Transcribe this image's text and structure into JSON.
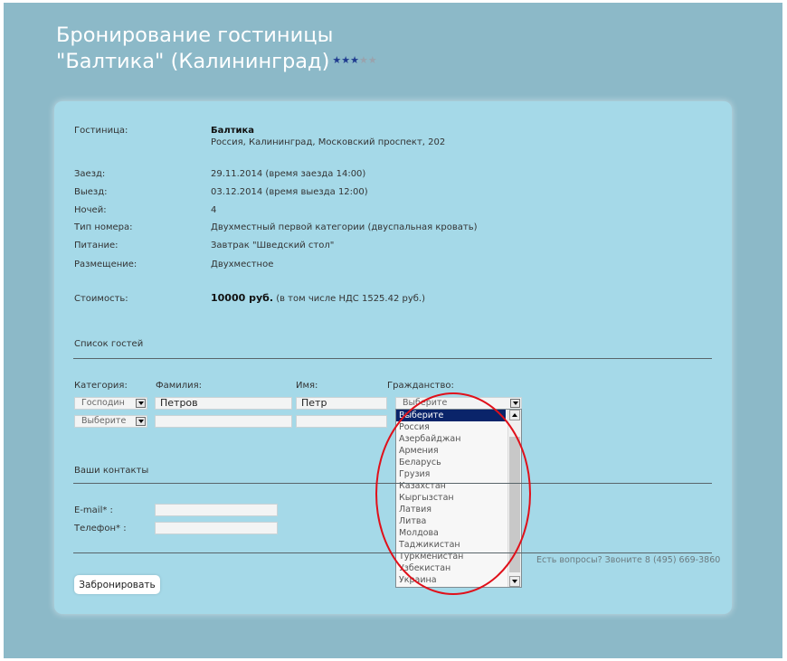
{
  "page": {
    "title_line1": "Бронирование гостиницы",
    "title_line2": "\"Балтика\" (Калининград)",
    "stars_filled": 3,
    "stars_total": 5,
    "colors": {
      "background": "#8cb9c8",
      "card": "#a5d9e8",
      "star_on": "#1f3b8f",
      "star_off": "#9aa3ad",
      "annotation": "#e0101a"
    }
  },
  "booking": {
    "hotel_label": "Гостиница:",
    "hotel_name": "Балтика",
    "hotel_address": "Россия, Калининград, Московский проспект, 202",
    "checkin_label": "Заезд:",
    "checkin_value": "29.11.2014 (время заезда 14:00)",
    "checkout_label": "Выезд:",
    "checkout_value": "03.12.2014 (время выезда 12:00)",
    "nights_label": "Ночей:",
    "nights_value": "4",
    "room_label": "Тип номера:",
    "room_value": "Двухместный первой категории (двуспальная кровать)",
    "meals_label": "Питание:",
    "meals_value": "Завтрак \"Шведский стол\"",
    "placement_label": "Размещение:",
    "placement_value": "Двухместное",
    "cost_label": "Стоимость:",
    "cost_amount": "10000 руб.",
    "cost_note": "(в том числе НДС 1525.42 руб.)"
  },
  "guests": {
    "section_title": "Список гостей",
    "col_category": "Категория:",
    "col_lastname": "Фамилия:",
    "col_firstname": "Имя:",
    "col_citizenship": "Гражданство:",
    "rows": [
      {
        "category": "Господин",
        "lastname": "Петров",
        "firstname": "Петр",
        "citizenship": "Выберите"
      },
      {
        "category": "Выберите",
        "lastname": "",
        "firstname": "",
        "citizenship": ""
      }
    ],
    "citizenship_options": [
      "Выберите",
      "Россия",
      "Азербайджан",
      "Армения",
      "Беларусь",
      "Грузия",
      "Казахстан",
      "Кыргызстан",
      "Латвия",
      "Литва",
      "Молдова",
      "Таджикистан",
      "Туркменистан",
      "Узбекистан",
      "Украина"
    ],
    "citizenship_selected": "Выберите"
  },
  "contacts": {
    "section_title": "Ваши контакты",
    "email_label": "E-mail* :",
    "phone_label": "Телефон* :",
    "email_value": "",
    "phone_value": ""
  },
  "footer": {
    "questions": "Есть вопросы? Звоните 8 (495) 669-3860",
    "submit_label": "Забронировать"
  }
}
